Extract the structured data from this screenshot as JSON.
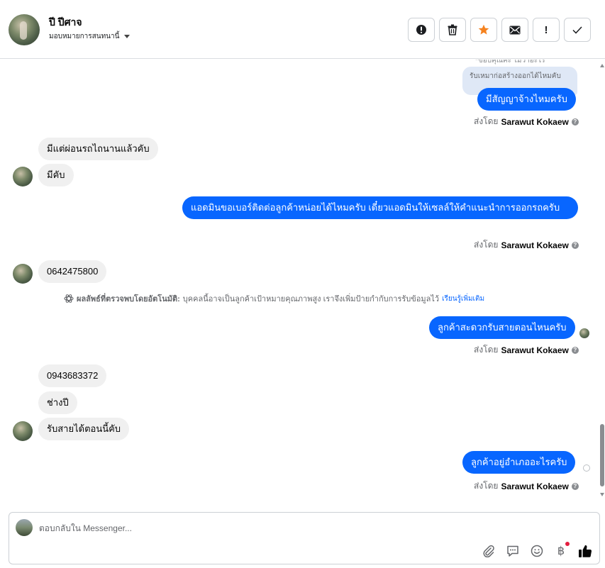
{
  "header": {
    "contact_name": "ปี ปีศาจ",
    "assign_label": "มอบหมายการสนทนานี้",
    "actions": [
      {
        "icon": "alert-circle-icon",
        "text": ""
      },
      {
        "icon": "trash-icon",
        "text": ""
      },
      {
        "icon": "star-icon",
        "text": "",
        "color": "#f5821f"
      },
      {
        "icon": "envelope-icon",
        "text": ""
      },
      {
        "icon": "exclamation-icon",
        "text": "!"
      },
      {
        "icon": "check-icon",
        "text": ""
      }
    ]
  },
  "messages": {
    "cut_text": "*ขอบคุณค่ะ ไม่ว่าอะไร",
    "reply_quote": "รับเหมาก่อสร้างออกได้ไหมคับ",
    "m1": "มีสัญญาจ้างไหมครับ",
    "m2": "มีแต่ผ่อนรถไถนานแล้วคับ",
    "m3": "มีคับ",
    "m4": "แอดมินขอเบอร์ติดต่อลูกค้าหน่อยได้ไหมครับ เดี๋ยวแอดมินให้เซลล์ให้คำแนะนำการออกรถครับ",
    "m5": "0642475800",
    "m6": "ลูกค้าสะดวกรับสายตอนไหนครับ",
    "m7": "0943683372",
    "m8": "ช่างปี",
    "m9": "รับสายได้ตอนนี้คับ",
    "m10": "ลูกค้าอยู่อำเภออะไรครับ"
  },
  "sent_by": {
    "prefix": "ส่งโดย",
    "name": "Sarawut Kokaew",
    "help": "?"
  },
  "auto_note": {
    "label": "ผลลัพธ์ที่ตรวจพบโดยอัตโนมัติ:",
    "text": "บุคคลนี้อาจเป็นลูกค้าเป้าหมายคุณภาพสูง เราจึงเพิ่มป้ายกำกับการรับข้อมูลไว้",
    "link": "เรียนรู้เพิ่มเติม"
  },
  "composer": {
    "placeholder": "ตอบกลับใน Messenger...",
    "tools": [
      "paperclip-icon",
      "comment-icon",
      "smile-icon",
      "baht-icon",
      "thumbs-up-icon"
    ],
    "baht_symbol": "฿"
  },
  "colors": {
    "outgoing": "#0866ff",
    "incoming": "#f0f0f0",
    "star": "#f5821f",
    "like": "#050505"
  }
}
